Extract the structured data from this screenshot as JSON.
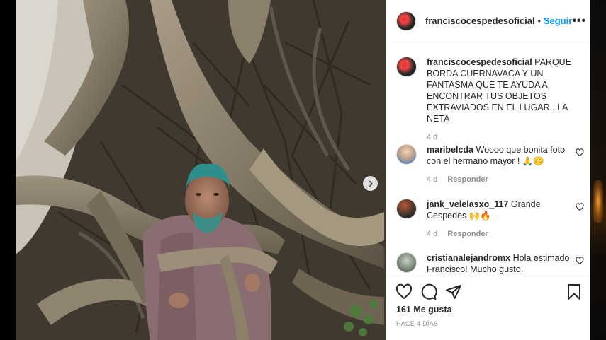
{
  "post": {
    "username": "franciscocespedesoficial",
    "follow_label": "Seguir",
    "more_label": "•••",
    "separator": "•"
  },
  "caption": {
    "username": "franciscocespedesoficial",
    "text": "PARQUE BORDA CUERNAVACA Y UN FANTASMA QUE TE AYUDA A ENCONTRAR TUS OBJETOS EXTRAVIADOS EN EL LUGAR...LA NETA",
    "age": "4 d"
  },
  "comments": [
    {
      "username": "maribelcda",
      "text": "Woooo que bonita foto con el hermano mayor ! 🙏😊",
      "age": "4 d",
      "reply_label": "Responder"
    },
    {
      "username": "jank_velelasxo_117",
      "text": "Grande Cespedes 🙌🔥",
      "age": "4 d",
      "reply_label": "Responder"
    },
    {
      "username": "cristianalejandromx",
      "text": "Hola estimado Francisco! Mucho gusto!",
      "age": "",
      "reply_label": ""
    }
  ],
  "likes": "161 Me gusta",
  "date": "HACE 4 DÍAS",
  "icons": {
    "like": "heart-icon",
    "comment": "comment-bubble-icon",
    "share": "paper-plane-icon",
    "save": "bookmark-icon",
    "next": "chevron-right-icon"
  },
  "colors": {
    "accent": "#0095f6",
    "text": "#262626",
    "muted": "#8e8e8e"
  }
}
